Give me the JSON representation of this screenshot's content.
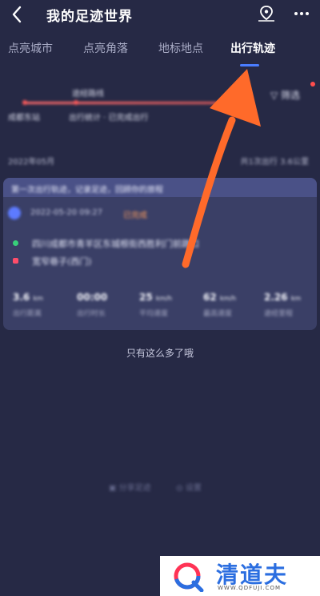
{
  "header": {
    "title": "我的足迹世界"
  },
  "tabs": [
    {
      "label": "点亮城市",
      "active": false
    },
    {
      "label": "点亮角落",
      "active": false
    },
    {
      "label": "地标地点",
      "active": false
    },
    {
      "label": "出行轨迹",
      "active": true
    }
  ],
  "route": {
    "top_label": "途经路线",
    "left_label": "成都东站",
    "mid_label": "出行统计 · 已完成出行",
    "filter_label": "▽ 筛选"
  },
  "section": {
    "left": "2022年05月",
    "right": "共1次出行  3.6公里"
  },
  "trip": {
    "banner": "第一次出行轨迹，记录足迹，回顾你的旅程",
    "time": "2022-05-20 09:27",
    "tag": "已完成",
    "from": "四川成都市青羊区东城根街西胜利门前路口",
    "to": "宽窄巷子(西门)"
  },
  "stats": [
    {
      "value": "3.6",
      "unit": "km",
      "label": "出行距离"
    },
    {
      "value": "00:00",
      "unit": "",
      "label": "出行时长"
    },
    {
      "value": "25",
      "unit": "km/h",
      "label": "平均速度"
    },
    {
      "value": "62",
      "unit": "km/h",
      "label": "最高速度"
    },
    {
      "value": "2.26",
      "unit": "km",
      "label": "途经里程"
    }
  ],
  "footer": {
    "end_text": "只有这么多了哦"
  },
  "bottom_actions": [
    {
      "label": "分享足迹"
    },
    {
      "label": "设置"
    }
  ],
  "watermark": {
    "brand": "清道夫",
    "url": "WWW.QDFUJI.COM"
  },
  "colors": {
    "background": "#262945",
    "accent": "#4a7dff",
    "arrow": "#ff6a2a"
  }
}
